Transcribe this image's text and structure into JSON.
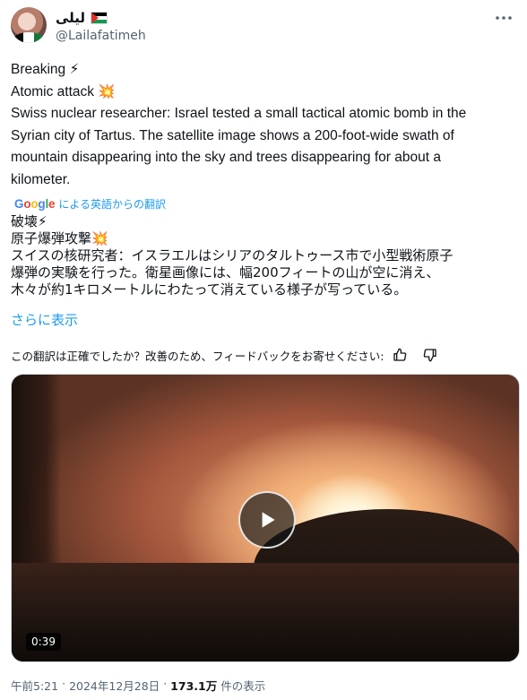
{
  "author": {
    "display_name": "ليلى",
    "handle": "@Lailafatimeh",
    "flag_icon": "palestine-flag-icon"
  },
  "post": {
    "lines": [
      "Breaking ⚡",
      "Atomic attack 💥",
      "Swiss nuclear researcher: Israel tested a small tactical atomic bomb in the",
      "Syrian city of Tartus. The satellite image shows a 200-foot-wide swath of",
      "mountain disappearing into the sky and trees disappearing for about a",
      "kilometer."
    ]
  },
  "translation": {
    "provider": "Google",
    "label": "による英語からの翻訳",
    "lines": [
      "破壊⚡",
      "原子爆弾攻撃💥",
      "スイスの核研究者：イスラエルはシリアのタルトゥース市で小型戦術原子",
      "爆弾の実験を行った。衛星画像には、幅200フィートの山が空に消え、",
      "木々が約1キロメートルにわたって消えている様子が写っている。"
    ],
    "show_more": "さらに表示",
    "feedback_question": "この翻訳は正確でしたか？改善のため、フィードバックをお寄せください:"
  },
  "video": {
    "duration": "0:39"
  },
  "meta": {
    "time": "午前5:21",
    "separator": "·",
    "date": "2024年12月28日",
    "views_count": "173.1万",
    "views_label": "件の表示"
  },
  "colors": {
    "link": "#1d9bf0",
    "secondary_text": "#536471"
  }
}
